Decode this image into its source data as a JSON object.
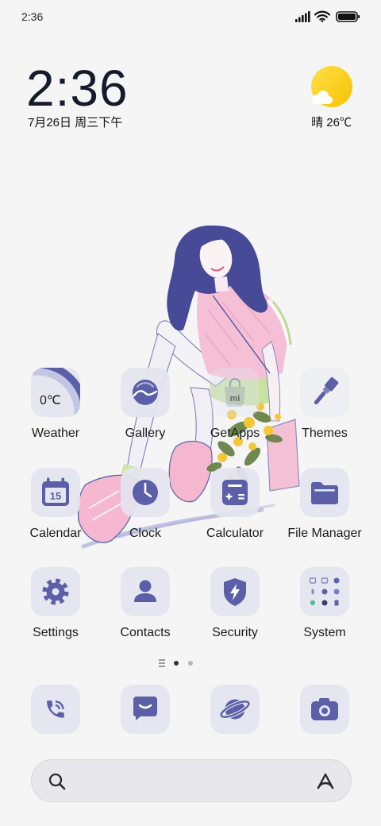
{
  "status_bar": {
    "time": "2:36",
    "signal_icon": "signal-icon",
    "wifi_icon": "wifi-icon",
    "battery_icon": "battery-icon",
    "battery_fill": 1.0
  },
  "clock_widget": {
    "time": "2:36",
    "date": "7月26日 周三下午"
  },
  "weather_widget": {
    "icon": "sun-cloud-icon",
    "summary": "晴 26℃"
  },
  "apps": [
    {
      "label": "Weather",
      "icon": "weather-icon",
      "icon_text": "0℃"
    },
    {
      "label": "Gallery",
      "icon": "gallery-icon"
    },
    {
      "label": "GetApps",
      "icon": "getapps-icon",
      "icon_text": "mi"
    },
    {
      "label": "Themes",
      "icon": "brush-icon"
    },
    {
      "label": "Calendar",
      "icon": "calendar-icon",
      "icon_text": "15"
    },
    {
      "label": "Clock",
      "icon": "clock-icon"
    },
    {
      "label": "Calculator",
      "icon": "calculator-icon"
    },
    {
      "label": "File Manager",
      "icon": "folder-icon"
    },
    {
      "label": "Settings",
      "icon": "gear-icon"
    },
    {
      "label": "Contacts",
      "icon": "person-icon"
    },
    {
      "label": "Security",
      "icon": "shield-icon"
    },
    {
      "label": "System",
      "icon": "app-folder-icon"
    }
  ],
  "page_indicator": {
    "menu_icon": "page-list-icon",
    "page_count": 2,
    "current_page": 1
  },
  "dock": [
    {
      "icon": "phone-icon"
    },
    {
      "icon": "messages-icon"
    },
    {
      "icon": "browser-icon"
    },
    {
      "icon": "camera-icon"
    }
  ],
  "search_bar": {
    "left_icon": "search-icon",
    "right_icon": "assistant-icon"
  },
  "colors": {
    "background": "#f5f5f6",
    "icon_accent": "#5b5fa7",
    "icon_tile": "#e3e4ee",
    "sun": "#fcd11a",
    "active_page_dot": "#333333",
    "inactive_page_dot": "#b5b5b8"
  }
}
